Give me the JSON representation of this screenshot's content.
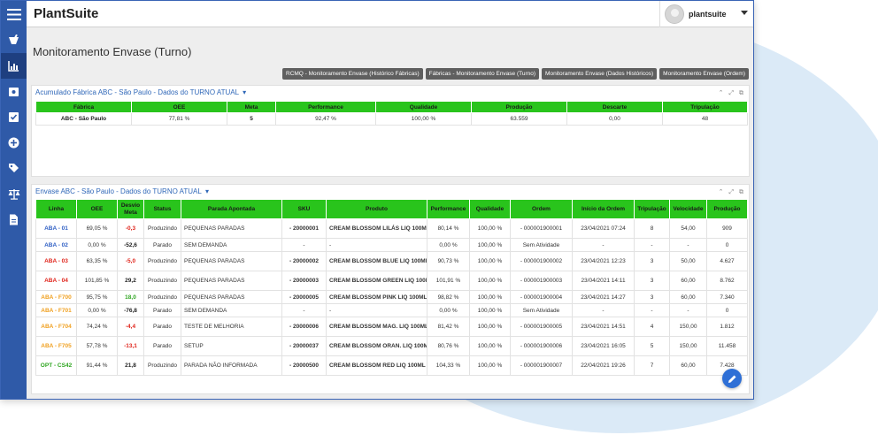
{
  "app": {
    "brand": "PlantSuite",
    "user": "plantsuite"
  },
  "sidebar": {
    "icons": [
      "menu-icon",
      "flask-icon",
      "chart-icon",
      "clipboard-icon",
      "check-icon",
      "plus-circle-icon",
      "tag-icon",
      "scale-icon",
      "document-icon"
    ]
  },
  "page": {
    "title": "Monitoramento Envase (Turno)"
  },
  "top_buttons": [
    "RCMQ - Monitoramento Envase (Histórico Fábricas)",
    "Fábricas - Monitoramento Envase (Turno)",
    "Monitoramento Envase (Dados Históricos)",
    "Monitoramento Envase (Ordem)"
  ],
  "panel1": {
    "title": "Acumulado Fábrica ABC - São Paulo - Dados do TURNO ATUAL",
    "headers": [
      "Fábrica",
      "OEE",
      "Meta",
      "Performance",
      "Qualidade",
      "Produção",
      "Descarte",
      "Tripulação"
    ],
    "row": [
      "ABC - São Paulo",
      "77,81 %",
      "5",
      "92,47 %",
      "100,00 %",
      "63.559",
      "0,00",
      "48"
    ]
  },
  "panel2": {
    "title": "Envase ABC - São Paulo - Dados do TURNO ATUAL",
    "headers": [
      "Linha",
      "OEE",
      "Desvio Meta",
      "Status",
      "Parada Apontada",
      "SKU",
      "Produto",
      "Performance",
      "Qualidade",
      "Ordem",
      "Início da Ordem",
      "Tripulação",
      "Velocidade",
      "Produção"
    ],
    "rows": [
      {
        "linha": "ABA - 01",
        "linha_color": "#2f5fc4",
        "oee": "69,05 %",
        "desvio": "-0,3",
        "desvio_class": "neg",
        "status": "Produzindo",
        "parada": "PEQUENAS PARADAS",
        "sku": "- 20000001",
        "produto": "CREAM BLOSSOM LILÁS LIQ 100ML",
        "perf": "80,14 %",
        "qual": "100,00 %",
        "ordem": "- 000001900001",
        "inicio": "23/04/2021 07:24",
        "trip": "8",
        "vel": "54,00",
        "prod": "909",
        "tall": true
      },
      {
        "linha": "ABA - 02",
        "linha_color": "#2f5fc4",
        "oee": "0,00 %",
        "desvio": "-52,6",
        "desvio_class": "dark",
        "status": "Parado",
        "parada": "SEM DEMANDA",
        "sku": "-",
        "produto": "-",
        "perf": "0,00 %",
        "qual": "100,00 %",
        "ordem": "Sem Atividade",
        "inicio": "-",
        "trip": "-",
        "vel": "-",
        "prod": "0",
        "tall": false
      },
      {
        "linha": "ABA - 03",
        "linha_color": "#e0241b",
        "oee": "63,35 %",
        "desvio": "-5,0",
        "desvio_class": "neg",
        "status": "Produzindo",
        "parada": "PEQUENAS PARADAS",
        "sku": "- 20000002",
        "produto": "CREAM BLOSSOM BLUE LIQ 100ML",
        "perf": "90,73 %",
        "qual": "100,00 %",
        "ordem": "- 000001900002",
        "inicio": "23/04/2021 12:23",
        "trip": "3",
        "vel": "50,00",
        "prod": "4.627",
        "tall": true
      },
      {
        "linha": "ABA - 04",
        "linha_color": "#e0241b",
        "oee": "101,85 %",
        "desvio": "29,2",
        "desvio_class": "dark",
        "status": "Produzindo",
        "parada": "PEQUENAS PARADAS",
        "sku": "- 20000003",
        "produto": "CREAM BLOSSOM GREEN LIQ 100ML",
        "perf": "101,91 %",
        "qual": "100,00 %",
        "ordem": "- 000001900003",
        "inicio": "23/04/2021 14:11",
        "trip": "3",
        "vel": "60,00",
        "prod": "8.762",
        "tall": true
      },
      {
        "linha": "ABA - F700",
        "linha_color": "#f0a020",
        "oee": "95,75 %",
        "desvio": "18,0",
        "desvio_class": "pos",
        "status": "Produzindo",
        "parada": "PEQUENAS PARADAS",
        "sku": "- 20000005",
        "produto": "CREAM BLOSSOM PINK LIQ 100ML",
        "perf": "98,82 %",
        "qual": "100,00 %",
        "ordem": "- 000001900004",
        "inicio": "23/04/2021 14:27",
        "trip": "3",
        "vel": "60,00",
        "prod": "7.340",
        "tall": false
      },
      {
        "linha": "ABA - F701",
        "linha_color": "#f0a020",
        "oee": "0,00 %",
        "desvio": "-76,8",
        "desvio_class": "dark",
        "status": "Parado",
        "parada": "SEM DEMANDA",
        "sku": "-",
        "produto": "-",
        "perf": "0,00 %",
        "qual": "100,00 %",
        "ordem": "Sem Atividade",
        "inicio": "-",
        "trip": "-",
        "vel": "-",
        "prod": "0",
        "tall": false
      },
      {
        "linha": "ABA - F704",
        "linha_color": "#f0a020",
        "oee": "74,24 %",
        "desvio": "-4,4",
        "desvio_class": "neg",
        "status": "Parado",
        "parada": "TESTE DE MELHORIA",
        "sku": "- 20000006",
        "produto": "CREAM BLOSSOM MAG. LIQ 100ML",
        "perf": "81,42 %",
        "qual": "100,00 %",
        "ordem": "- 000001900005",
        "inicio": "23/04/2021 14:51",
        "trip": "4",
        "vel": "150,00",
        "prod": "1.812",
        "tall": true
      },
      {
        "linha": "ABA - F705",
        "linha_color": "#f0a020",
        "oee": "57,78 %",
        "desvio": "-13,1",
        "desvio_class": "neg",
        "status": "Parado",
        "parada": "SETUP",
        "sku": "- 20000037",
        "produto": "CREAM BLOSSOM ORAN. LIQ 100ML",
        "perf": "80,76 %",
        "qual": "100,00 %",
        "ordem": "- 000001900006",
        "inicio": "23/04/2021 16:05",
        "trip": "5",
        "vel": "150,00",
        "prod": "11.458",
        "tall": true
      },
      {
        "linha": "OPT - CS42",
        "linha_color": "#2ea520",
        "oee": "91,44 %",
        "desvio": "21,8",
        "desvio_class": "dark",
        "status": "Produzindo",
        "parada": "PARADA NÃO INFORMADA",
        "sku": "- 20000500",
        "produto": "CREAM BLOSSOM RED LIQ 100ML",
        "perf": "104,33 %",
        "qual": "100,00 %",
        "ordem": "- 000001900007",
        "inicio": "22/04/2021 19:26",
        "trip": "7",
        "vel": "60,00",
        "prod": "7.428",
        "tall": true
      }
    ]
  }
}
